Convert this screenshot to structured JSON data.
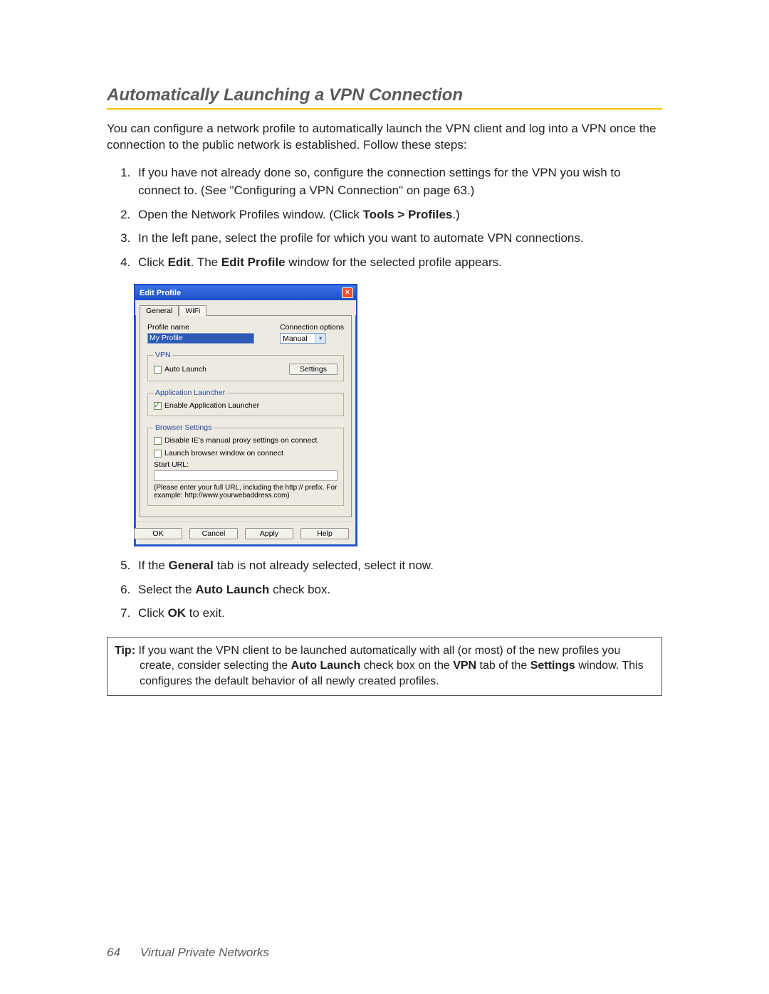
{
  "heading": "Automatically Launching a VPN Connection",
  "intro": "You can configure a network profile to automatically launch the VPN client and log into a VPN once the connection to the public network is established. Follow these steps:",
  "steps": {
    "s1": "If you have not already done so, configure the connection settings for the VPN you wish to connect to. (See \"Configuring a VPN Connection\" on page 63.)",
    "s2_a": "Open the Network Profiles window. (Click ",
    "s2_b": "Tools > Profiles",
    "s2_c": ".)",
    "s3": "In the left pane, select the profile for which you want to automate VPN connections.",
    "s4_a": "Click ",
    "s4_b": "Edit",
    "s4_c": ". The ",
    "s4_d": "Edit Profile",
    "s4_e": " window for the selected profile appears.",
    "s5_a": "If the ",
    "s5_b": "General",
    "s5_c": " tab is not already selected, select it now.",
    "s6_a": "Select the ",
    "s6_b": "Auto Launch",
    "s6_c": " check box.",
    "s7_a": "Click ",
    "s7_b": "OK",
    "s7_c": " to exit."
  },
  "dialog": {
    "title": "Edit Profile",
    "tabs": {
      "general": "General",
      "wifi": "WiFi"
    },
    "profile_name_label": "Profile name",
    "profile_name_value": "My Profile",
    "connection_options_label": "Connection options",
    "connection_options_value": "Manual",
    "fs_vpn": "VPN",
    "auto_launch": "Auto Launch",
    "settings_btn": "Settings",
    "fs_app": "Application Launcher",
    "enable_app": "Enable Application Launcher",
    "fs_browser": "Browser Settings",
    "disable_ie": "Disable IE's manual proxy settings on connect",
    "launch_browser": "Launch browser window on connect",
    "start_url": "Start URL:",
    "url_hint": "(Please enter your full URL, including the http:// prefix. For example: http://www.yourwebaddress.com)",
    "ok": "OK",
    "cancel": "Cancel",
    "apply": "Apply",
    "help": "Help"
  },
  "tip": {
    "label": "Tip:",
    "t1": " If you want the VPN client to be launched automatically with all (or most) of the new profiles you create, consider selecting the ",
    "t2": "Auto Launch",
    "t3": " check box on the ",
    "t4": "VPN",
    "t5": " tab of the ",
    "t6": "Settings",
    "t7": " window. This configures the default behavior of all newly created profiles."
  },
  "footer": {
    "page": "64",
    "section": "Virtual Private Networks"
  }
}
